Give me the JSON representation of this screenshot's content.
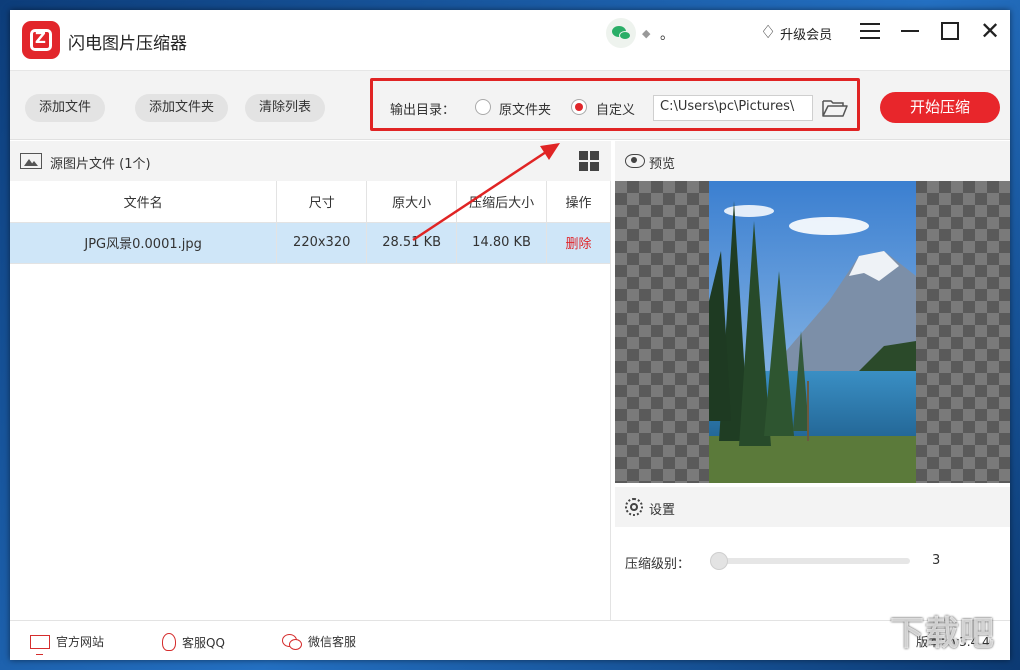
{
  "app": {
    "title": "闪电图片压缩器",
    "dot_text": "。",
    "upgrade_label": "升级会员"
  },
  "toolbar": {
    "add_file": "添加文件",
    "add_folder": "添加文件夹",
    "clear_list": "清除列表",
    "output_dir_label": "输出目录：",
    "radio_original": "原文件夹",
    "radio_custom": "自定义",
    "selected": "自定义",
    "path": "C:\\Users\\pc\\Pictures\\",
    "start_button": "开始压缩"
  },
  "source": {
    "title": "源图片文件 (1个)",
    "columns": [
      "文件名",
      "尺寸",
      "原大小",
      "压缩后大小",
      "操作"
    ],
    "rows": [
      {
        "name": "JPG风景0.0001.jpg",
        "size": "220x320",
        "original": "28.51 KB",
        "compressed": "14.80 KB",
        "action": "删除"
      }
    ]
  },
  "preview": {
    "title": "预览"
  },
  "settings": {
    "title": "设置",
    "level_label": "压缩级别：",
    "level_value": "3",
    "level_fraction": 0.0
  },
  "footer": {
    "website": "官方网站",
    "qq": "客服QQ",
    "wechat": "微信客服",
    "version": "版本：v3.4.4"
  },
  "watermark": "下载吧",
  "colors": {
    "accent": "#e8262b",
    "selected_row": "#cfe6f8",
    "annotation": "#e02424"
  }
}
